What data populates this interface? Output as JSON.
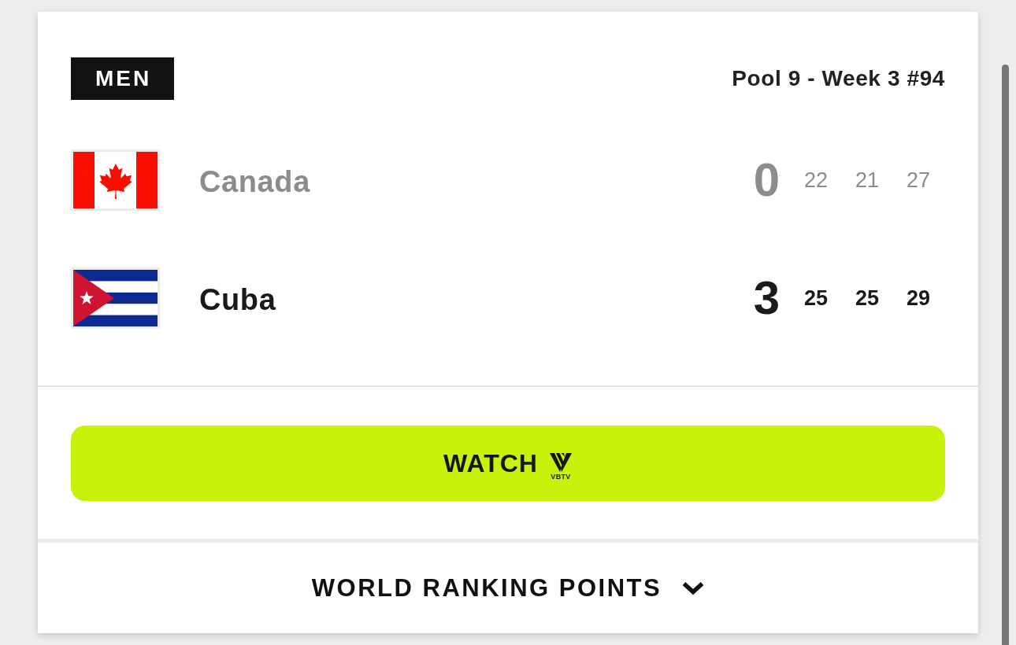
{
  "badge": "MEN",
  "title": "Pool 9 - Week 3 #94",
  "teams": [
    {
      "kind": "canada",
      "name": "Canada",
      "winner": false,
      "sets_won": "0",
      "set_scores": [
        "22",
        "21",
        "27"
      ]
    },
    {
      "kind": "cuba",
      "name": "Cuba",
      "winner": true,
      "sets_won": "3",
      "set_scores": [
        "25",
        "25",
        "29"
      ]
    }
  ],
  "watch_button": {
    "label": "WATCH",
    "logo_text": "VBTV"
  },
  "ranking_points": {
    "label": "WORLD RANKING POINTS",
    "expanded": false
  }
}
